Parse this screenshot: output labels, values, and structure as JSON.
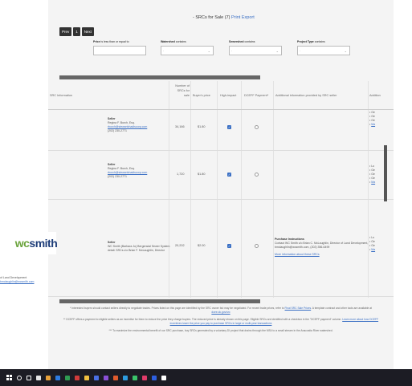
{
  "header": {
    "title": "- SRCs for Sale",
    "count": "(7)",
    "print_label": "Print",
    "export_label": "Export"
  },
  "pager": {
    "prev": "Prev",
    "page": "1",
    "next": "Next"
  },
  "filters": {
    "price": {
      "label": "Price",
      "label_rest": "is less than or equal to",
      "value": ""
    },
    "watershed": {
      "label": "Watershed",
      "label_rest": "contains",
      "value": "-"
    },
    "sewershed": {
      "label": "Sewershed",
      "label_rest": "contains",
      "value": "-"
    },
    "project_type": {
      "label": "Project Type",
      "label_rest": "contains",
      "value": "-"
    }
  },
  "columns": {
    "src_info": "SRC Information",
    "num_srcs_1": "Number of",
    "num_srcs_2": "SRCs for",
    "num_srcs_3": "sale",
    "buyer_price": "Buyer's price",
    "high_impact": "High-impact",
    "dceff": "DCEFF Payment*",
    "additional": "Additional information provided by SRC seller",
    "addl_trunc": "Addition"
  },
  "rows": [
    {
      "seller_label": "Seller",
      "seller_name": "Regina F. Burch, Esq.",
      "seller_email": "rburch@stewartchadiscorp.com",
      "seller_phone": "(202) 230-2771",
      "num": "34,166",
      "price": "$1.80",
      "bullets": [
        "Ge",
        "Ge",
        "Ge",
        "Ma"
      ]
    },
    {
      "seller_label": "Seller",
      "seller_name": "Regina F. Burch, Esq.",
      "seller_email": "rburch@stewartchadiscorp.com",
      "seller_phone": "(202) 230-2771",
      "num": "1,720",
      "price": "$1.80",
      "bullets": [
        "Lo",
        "Ge",
        "Ge",
        "Ge",
        "Ma"
      ]
    },
    {
      "seller_label": "Seller",
      "seller_name": "WC Smith (Barbara Jo) Bergenstal Sewer System",
      "seller_name_2": "detail: SRCs c/o Brian F. McLaughlin, Director",
      "num": "20,202",
      "price": "$2.00",
      "addl_title": "Purchase Instructions",
      "addl_text": "Contact WC Smith c/o Brian C. McLaughlin, Director of Land Development, bmclaughlin@wcsmith.com, (202) 356-6499",
      "addl_link": "More information about these SRCs",
      "bullets": [
        "Lo",
        "Ge",
        "Ge",
        "Ma"
      ],
      "partial_text": "of Land Development",
      "partial_email": "bmclaughlin@wcsmith.com"
    }
  ],
  "logo": {
    "wc": "wc",
    "rest": "smith"
  },
  "footnotes": {
    "line1": "* Interested buyers should contact sellers directly to negotiate trades. Prices listed on this page are identified by the SRC owner but may be negotiated. For recent trade prices, refer to",
    "line1_link": "Final SRC Sale Prices",
    "line1_rest": ". A template contract and other tools are available at",
    "line1_link2": "doee.dc.gov/src",
    "line2": "** DCEFF offers a payment to eligible sellers as an incentive for them to reduce the price they charge buyers. The reduced price is already shown on this page. Eligible SRCs are identified with a checkbox in the \"DCEFF payment\" column.",
    "line2_link": "Learn more about how DCEFF incentives lower the price you pay to purchase SRCs in large or multi-year transactions",
    "line3": "*** To maximize the environmental benefit of our SRC purchase, buy SRCs generated by a voluntary DI project that drains through the MS4 to a small stream in the Anacostia River watershed."
  },
  "taskbar": {
    "icons": [
      "start-icon",
      "search-icon",
      "task-view-icon",
      "widgets-icon",
      "app-icon-1",
      "app-icon-2",
      "app-icon-3",
      "app-icon-4",
      "app-icon-5",
      "app-icon-6",
      "app-icon-7",
      "app-icon-8",
      "app-icon-9",
      "app-icon-10",
      "app-icon-11",
      "app-icon-12",
      "app-icon-13"
    ]
  }
}
